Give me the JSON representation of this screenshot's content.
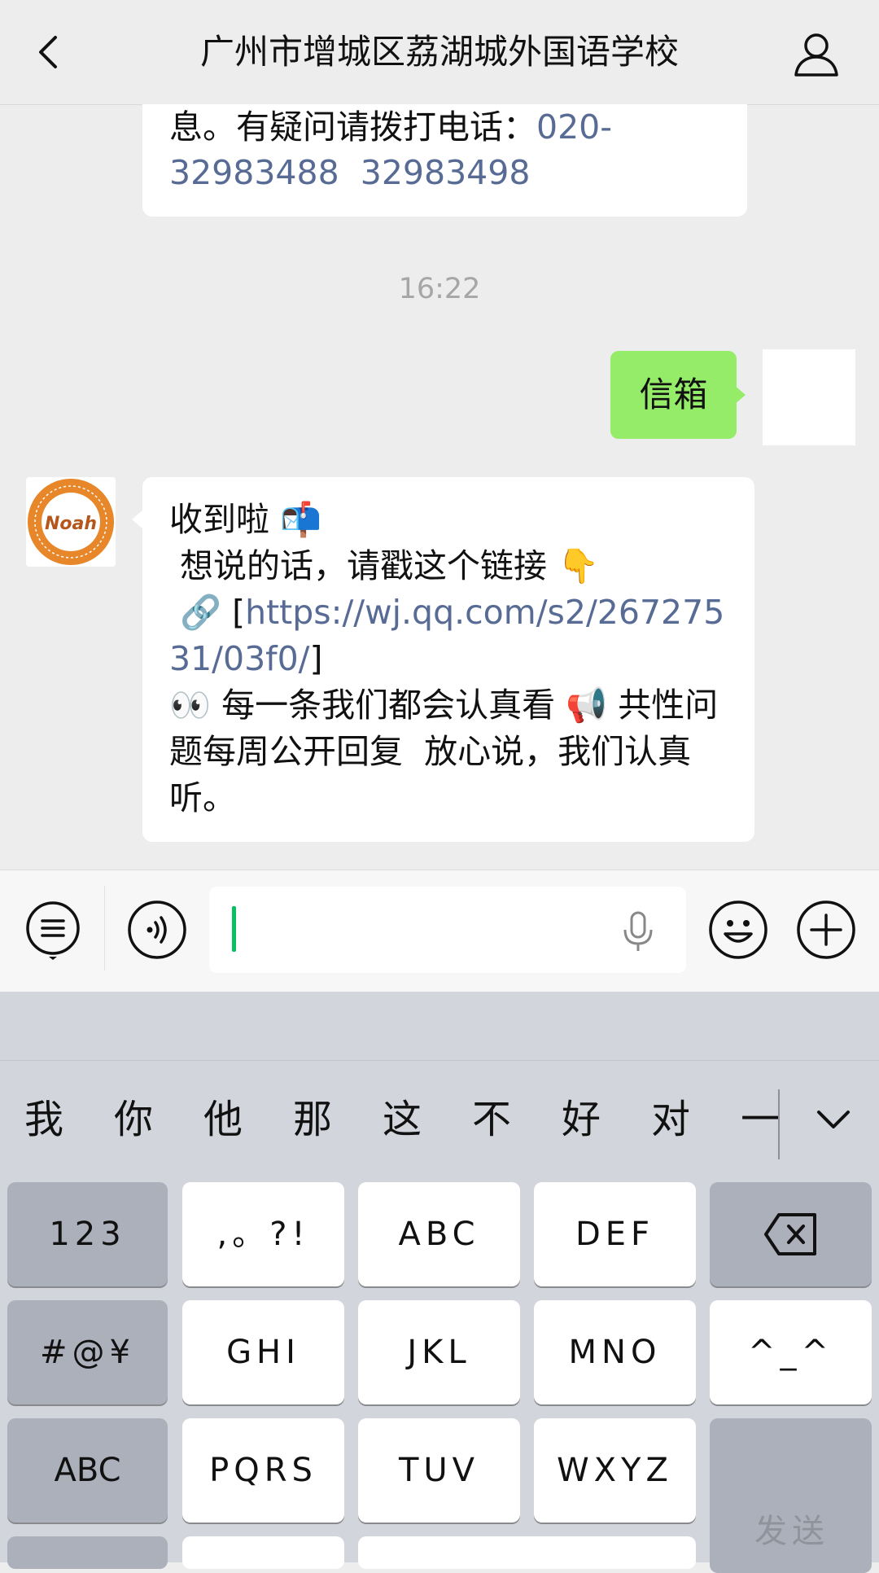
{
  "header": {
    "title": "广州市增城区荔湖城外国语学校",
    "back_icon": "chevron-left-icon",
    "profile_icon": "person-icon"
  },
  "chat": {
    "prev_message": {
      "text": "息。有疑问请拨打电话：",
      "phone_part1": "020-",
      "phone_part2": "32983488  32983498"
    },
    "timestamp": "16:22",
    "sent_message": "信箱",
    "reply": {
      "line1": "收到啦 📬",
      "line2": " 想说的话，请戳这个链接 👇",
      "line3_prefix": " 🔗 [",
      "link": "https://wj.qq.com/s2/26727531/03f0/",
      "line3_suffix": "]",
      "line4": "👀 每一条我们都会认真看 📢 共性问题每周公开回复  放心说，我们认真听。",
      "avatar_label": "Noah"
    }
  },
  "input_bar": {
    "menu_icon": "menu-list-icon",
    "voice_icon": "voice-icon",
    "mic_icon": "microphone-icon",
    "emoji_icon": "emoji-icon",
    "plus_icon": "plus-icon"
  },
  "keyboard": {
    "candidates": [
      "我",
      "你",
      "他",
      "那",
      "这",
      "不",
      "好",
      "对",
      "一"
    ],
    "rows": [
      [
        "123",
        ",。?!",
        "ABC",
        "DEF"
      ],
      [
        "#@¥",
        "GHI",
        "JKL",
        "MNO",
        "^_^"
      ],
      [
        "ABC",
        "PQRS",
        "TUV",
        "WXYZ"
      ]
    ],
    "send": "发送"
  }
}
